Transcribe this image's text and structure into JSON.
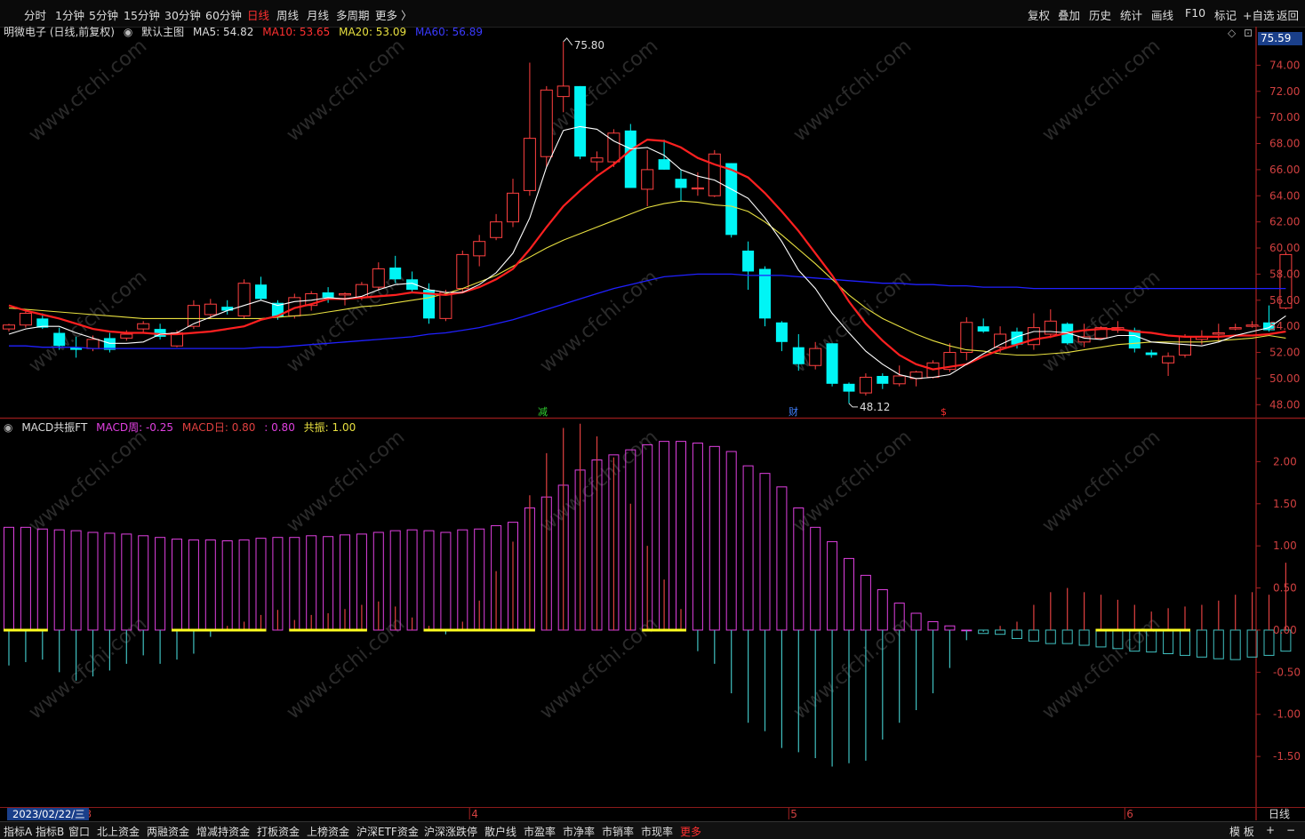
{
  "toolbar": {
    "left": [
      "分时",
      "1分钟",
      "5分钟",
      "15分钟",
      "30分钟",
      "60分钟",
      "日线",
      "周线",
      "月线",
      "多周期",
      "更多 〉"
    ],
    "active": "日线",
    "right": [
      "复权",
      "叠加",
      "历史",
      "统计",
      "画线",
      "F10",
      "标记",
      "+自选",
      "返回"
    ]
  },
  "info": {
    "stock": "明微电子 (日线,前复权)",
    "template": "默认主图",
    "ma5": "MA5: 54.82",
    "ma10": "MA10: 53.65",
    "ma20": "MA20: 53.09",
    "ma60": "MA60: 56.89",
    "diamond": "◇",
    "tile": "⊡"
  },
  "macd_info": {
    "name": "MACD共振FT",
    "week": "MACD周: -0.25",
    "day": "MACD日: 0.80",
    "extra": ": 0.80",
    "resonance": "共振: 1.00"
  },
  "price_tag": "75.59",
  "annotations": {
    "high": "75.80",
    "low": "48.12",
    "mark_jian": "减",
    "mark_cai": "财",
    "mark_s": "$"
  },
  "date_label": "2023/02/22/三",
  "month_labels": [
    "3",
    "4",
    "5",
    "6"
  ],
  "period_label": "日线",
  "bottom": {
    "tabs": [
      "指标A",
      "指标B",
      "窗口",
      "北上资金",
      "两融资金",
      "增减持资金",
      "打板资金",
      "上榜资金",
      "沪深ETF资金",
      "沪深涨跌停",
      "散户线",
      "市盈率",
      "市净率",
      "市销率",
      "市现率",
      "更多"
    ],
    "right": [
      "模 板",
      "+",
      "−"
    ]
  },
  "watermark": "www.cfchi.com",
  "chart_data": [
    {
      "type": "candlestick",
      "title": "明微电子 (日线,前复权)",
      "ylim": [
        47,
        76
      ],
      "yticks": [
        48,
        50,
        52,
        54,
        56,
        58,
        60,
        62,
        64,
        66,
        68,
        70,
        72,
        74
      ],
      "colors": {
        "up": "#ff4040",
        "down": "#00f5f5",
        "ma5": "#ffffff",
        "ma10": "#ff2020",
        "ma20": "#e8e040",
        "ma60": "#2020ff"
      },
      "candles": [
        [
          53.8,
          54.2,
          53.6,
          54.1
        ],
        [
          54.1,
          55.2,
          53.9,
          55.0
        ],
        [
          54.6,
          55.0,
          53.8,
          53.9
        ],
        [
          53.5,
          53.9,
          52.2,
          52.5
        ],
        [
          52.4,
          53.2,
          51.6,
          52.2
        ],
        [
          52.3,
          53.3,
          52.1,
          53.0
        ],
        [
          53.1,
          53.5,
          52.0,
          52.2
        ],
        [
          53.1,
          53.7,
          52.9,
          53.4
        ],
        [
          53.8,
          54.4,
          53.5,
          54.2
        ],
        [
          53.8,
          54.2,
          53.0,
          53.2
        ],
        [
          52.5,
          53.7,
          52.4,
          53.5
        ],
        [
          54.0,
          56.0,
          53.8,
          55.6
        ],
        [
          54.9,
          56.1,
          54.6,
          55.7
        ],
        [
          55.5,
          56.0,
          54.9,
          55.2
        ],
        [
          54.8,
          57.6,
          54.6,
          57.3
        ],
        [
          57.2,
          57.8,
          56.0,
          56.1
        ],
        [
          55.8,
          56.0,
          54.5,
          54.7
        ],
        [
          54.8,
          56.5,
          54.6,
          56.2
        ],
        [
          55.6,
          56.7,
          55.2,
          56.5
        ],
        [
          56.6,
          57.0,
          55.8,
          56.2
        ],
        [
          56.4,
          56.6,
          55.6,
          56.5
        ],
        [
          56.2,
          57.4,
          56.0,
          57.2
        ],
        [
          57.0,
          58.9,
          56.8,
          58.4
        ],
        [
          58.5,
          59.4,
          57.3,
          57.6
        ],
        [
          57.6,
          58.2,
          56.6,
          56.8
        ],
        [
          56.8,
          57.3,
          54.2,
          54.6
        ],
        [
          54.6,
          56.8,
          54.4,
          56.6
        ],
        [
          56.9,
          59.8,
          56.6,
          59.5
        ],
        [
          59.4,
          61.0,
          58.6,
          60.5
        ],
        [
          60.8,
          62.6,
          60.6,
          62.0
        ],
        [
          62.0,
          65.3,
          61.6,
          64.2
        ],
        [
          64.4,
          74.2,
          64.0,
          68.4
        ],
        [
          67.0,
          72.4,
          66.2,
          72.1
        ],
        [
          71.6,
          75.8,
          70.4,
          72.4
        ],
        [
          72.4,
          72.4,
          66.8,
          67.0
        ],
        [
          66.6,
          67.4,
          65.9,
          66.9
        ],
        [
          66.6,
          69.1,
          66.2,
          68.8
        ],
        [
          69.0,
          69.5,
          64.6,
          64.6
        ],
        [
          64.5,
          67.5,
          63.2,
          66.0
        ],
        [
          66.8,
          68.3,
          66.0,
          66.0
        ],
        [
          65.3,
          66.0,
          63.6,
          64.6
        ],
        [
          64.6,
          65.8,
          64.0,
          64.6
        ],
        [
          64.0,
          67.5,
          63.9,
          67.2
        ],
        [
          66.5,
          66.5,
          60.8,
          61.0
        ],
        [
          59.8,
          60.5,
          56.8,
          58.2
        ],
        [
          58.4,
          58.6,
          54.0,
          54.6
        ],
        [
          54.3,
          54.4,
          52.1,
          52.8
        ],
        [
          52.4,
          53.4,
          50.6,
          51.1
        ],
        [
          51.0,
          52.8,
          50.7,
          52.3
        ],
        [
          52.7,
          52.7,
          49.4,
          49.6
        ],
        [
          49.6,
          49.7,
          48.1,
          49.0
        ],
        [
          48.9,
          50.4,
          48.7,
          50.1
        ],
        [
          50.2,
          50.4,
          49.2,
          49.6
        ],
        [
          49.6,
          51.0,
          49.4,
          50.2
        ],
        [
          50.0,
          50.6,
          49.4,
          50.5
        ],
        [
          50.1,
          51.4,
          50.0,
          51.2
        ],
        [
          50.7,
          52.7,
          50.5,
          52.0
        ],
        [
          52.0,
          54.7,
          51.4,
          54.3
        ],
        [
          54.0,
          54.6,
          53.5,
          53.6
        ],
        [
          52.4,
          54.0,
          52.0,
          53.4
        ],
        [
          53.6,
          53.9,
          52.3,
          52.6
        ],
        [
          52.6,
          55.0,
          52.2,
          53.9
        ],
        [
          53.4,
          55.3,
          53.1,
          54.4
        ],
        [
          54.2,
          54.3,
          52.6,
          52.7
        ],
        [
          52.8,
          54.2,
          52.4,
          53.2
        ],
        [
          53.1,
          54.0,
          53.0,
          53.9
        ],
        [
          53.7,
          54.4,
          53.5,
          53.9
        ],
        [
          53.7,
          53.9,
          52.0,
          52.3
        ],
        [
          52.0,
          52.2,
          51.6,
          51.8
        ],
        [
          51.2,
          52.0,
          50.2,
          51.7
        ],
        [
          51.8,
          53.4,
          51.6,
          53.2
        ],
        [
          53.0,
          53.7,
          52.6,
          53.2
        ],
        [
          53.4,
          54.2,
          52.8,
          53.5
        ],
        [
          53.8,
          54.2,
          53.7,
          53.9
        ],
        [
          54.0,
          54.4,
          53.9,
          54.1
        ],
        [
          54.3,
          55.6,
          53.6,
          53.7
        ],
        [
          55.4,
          59.7,
          55.3,
          59.5
        ]
      ],
      "ma": {
        "ma5": [
          53.4,
          53.8,
          54.0,
          54.0,
          53.5,
          53.1,
          52.7,
          52.7,
          52.8,
          53.4,
          53.5,
          54.2,
          54.7,
          55.2,
          55.6,
          56.0,
          55.6,
          55.9,
          56.0,
          56.2,
          56.1,
          56.3,
          56.8,
          57.2,
          57.3,
          56.8,
          56.6,
          56.6,
          57.2,
          58.1,
          59.6,
          62.3,
          66.2,
          69.0,
          69.3,
          69.1,
          68.2,
          67.6,
          67.7,
          67.1,
          66.0,
          65.5,
          65.2,
          64.5,
          63.8,
          62.3,
          60.5,
          58.3,
          56.9,
          55.0,
          53.5,
          52.1,
          51.1,
          50.3,
          50.0,
          50.1,
          50.3,
          51.1,
          51.9,
          52.6,
          53.2,
          53.6,
          53.6,
          53.5,
          53.1,
          53.0,
          53.3,
          53.3,
          52.8,
          52.7,
          52.6,
          52.5,
          52.8,
          53.3,
          53.6,
          53.9,
          54.8
        ],
        "ma10": [
          55.6,
          55.2,
          54.9,
          54.6,
          54.2,
          53.8,
          53.6,
          53.5,
          53.5,
          53.4,
          53.4,
          53.5,
          53.6,
          53.8,
          54.0,
          54.5,
          54.8,
          55.4,
          55.7,
          56.1,
          56.1,
          56.2,
          56.3,
          56.4,
          56.6,
          56.5,
          56.4,
          56.6,
          57.0,
          57.6,
          58.4,
          59.9,
          61.6,
          63.2,
          64.4,
          65.5,
          66.4,
          67.5,
          68.3,
          68.2,
          67.7,
          66.9,
          66.4,
          66.0,
          65.4,
          64.2,
          62.8,
          61.3,
          59.6,
          57.9,
          55.9,
          54.2,
          52.9,
          51.8,
          51.1,
          50.7,
          50.9,
          51.1,
          51.7,
          52.2,
          52.6,
          53.0,
          53.2,
          53.5,
          53.7,
          53.8,
          53.8,
          53.6,
          53.5,
          53.3,
          53.2,
          53.2,
          53.2,
          53.3,
          53.3,
          53.4,
          53.6
        ],
        "ma20": [
          55.4,
          55.3,
          55.2,
          55.1,
          55.0,
          54.9,
          54.8,
          54.7,
          54.6,
          54.6,
          54.6,
          54.6,
          54.6,
          54.6,
          54.6,
          54.6,
          54.7,
          54.8,
          54.9,
          55.1,
          55.3,
          55.5,
          55.6,
          55.8,
          56.0,
          56.2,
          56.5,
          56.9,
          57.4,
          57.9,
          58.6,
          59.3,
          60.0,
          60.6,
          61.1,
          61.6,
          62.1,
          62.6,
          63.1,
          63.4,
          63.6,
          63.5,
          63.3,
          63.2,
          62.8,
          62.0,
          61.0,
          59.9,
          58.8,
          57.6,
          56.4,
          55.4,
          54.6,
          54.0,
          53.4,
          52.9,
          52.5,
          52.2,
          52.1,
          51.9,
          51.8,
          51.8,
          51.9,
          52.0,
          52.2,
          52.4,
          52.6,
          52.7,
          52.8,
          52.8,
          52.8,
          52.8,
          52.9,
          53.0,
          53.1,
          53.3,
          53.1
        ],
        "ma60": [
          52.5,
          52.5,
          52.4,
          52.4,
          52.4,
          52.3,
          52.3,
          52.3,
          52.3,
          52.3,
          52.3,
          52.3,
          52.3,
          52.3,
          52.3,
          52.4,
          52.4,
          52.5,
          52.6,
          52.7,
          52.8,
          52.9,
          53.0,
          53.1,
          53.2,
          53.4,
          53.5,
          53.7,
          53.9,
          54.2,
          54.5,
          54.9,
          55.3,
          55.7,
          56.1,
          56.5,
          56.9,
          57.2,
          57.5,
          57.8,
          57.9,
          58.0,
          58.0,
          58.0,
          57.9,
          57.9,
          57.9,
          57.8,
          57.7,
          57.6,
          57.5,
          57.4,
          57.3,
          57.3,
          57.2,
          57.2,
          57.1,
          57.1,
          57.0,
          57.0,
          57.0,
          56.9,
          56.9,
          56.9,
          56.9,
          56.9,
          56.9,
          56.9,
          56.9,
          56.9,
          56.9,
          56.9,
          56.9,
          56.9,
          56.9,
          56.9,
          56.9
        ]
      }
    },
    {
      "type": "bar",
      "title": "MACD共振FT",
      "ylim": [
        -2.1,
        2.5
      ],
      "yticks": [
        2.0,
        1.5,
        1.0,
        0.5,
        0.0,
        -0.5,
        -1.0,
        -1.5
      ],
      "colors": {
        "week": "#e040e0",
        "day_pos": "#e04040",
        "day_neg": "#40c0c0",
        "resonance": "#ffff20"
      },
      "macd_week": [
        1.22,
        1.22,
        1.2,
        1.19,
        1.18,
        1.16,
        1.15,
        1.14,
        1.12,
        1.1,
        1.08,
        1.07,
        1.07,
        1.06,
        1.07,
        1.09,
        1.1,
        1.1,
        1.12,
        1.11,
        1.13,
        1.14,
        1.16,
        1.18,
        1.19,
        1.18,
        1.16,
        1.19,
        1.2,
        1.24,
        1.28,
        1.45,
        1.58,
        1.72,
        1.9,
        2.02,
        2.08,
        2.14,
        2.2,
        2.24,
        2.24,
        2.22,
        2.18,
        2.12,
        1.95,
        1.86,
        1.7,
        1.45,
        1.22,
        1.05,
        0.85,
        0.65,
        0.48,
        0.32,
        0.2,
        0.1,
        0.05,
        0.0,
        -0.04,
        -0.05,
        -0.1,
        -0.13,
        -0.16,
        -0.16,
        -0.18,
        -0.2,
        -0.22,
        -0.25,
        -0.26,
        -0.28,
        -0.3,
        -0.32,
        -0.34,
        -0.35,
        -0.32,
        -0.3,
        -0.25
      ],
      "macd_day": [
        -0.42,
        -0.38,
        -0.35,
        -0.5,
        -0.6,
        -0.55,
        -0.48,
        -0.4,
        -0.3,
        -0.4,
        -0.35,
        -0.28,
        -0.08,
        0.05,
        0.1,
        0.18,
        0.24,
        0.12,
        0.18,
        0.2,
        0.25,
        0.3,
        0.34,
        0.28,
        0.15,
        0.05,
        -0.05,
        0.1,
        0.35,
        0.7,
        1.05,
        1.6,
        2.1,
        2.4,
        2.45,
        2.3,
        2.05,
        1.5,
        1.0,
        0.6,
        0.25,
        -0.25,
        -0.4,
        -0.75,
        -1.1,
        -1.2,
        -1.4,
        -1.45,
        -1.52,
        -1.62,
        -1.58,
        -1.55,
        -1.3,
        -1.1,
        -0.95,
        -0.75,
        -0.45,
        -0.12,
        -0.02,
        0.05,
        0.1,
        0.3,
        0.45,
        0.5,
        0.45,
        0.42,
        0.36,
        0.3,
        0.22,
        0.26,
        0.28,
        0.3,
        0.35,
        0.42,
        0.45,
        0.42,
        0.8
      ],
      "resonance_segments": [
        [
          0,
          2
        ],
        [
          10,
          15
        ],
        [
          17,
          21
        ],
        [
          25,
          31
        ],
        [
          38,
          40
        ],
        [
          65,
          70
        ]
      ]
    }
  ]
}
